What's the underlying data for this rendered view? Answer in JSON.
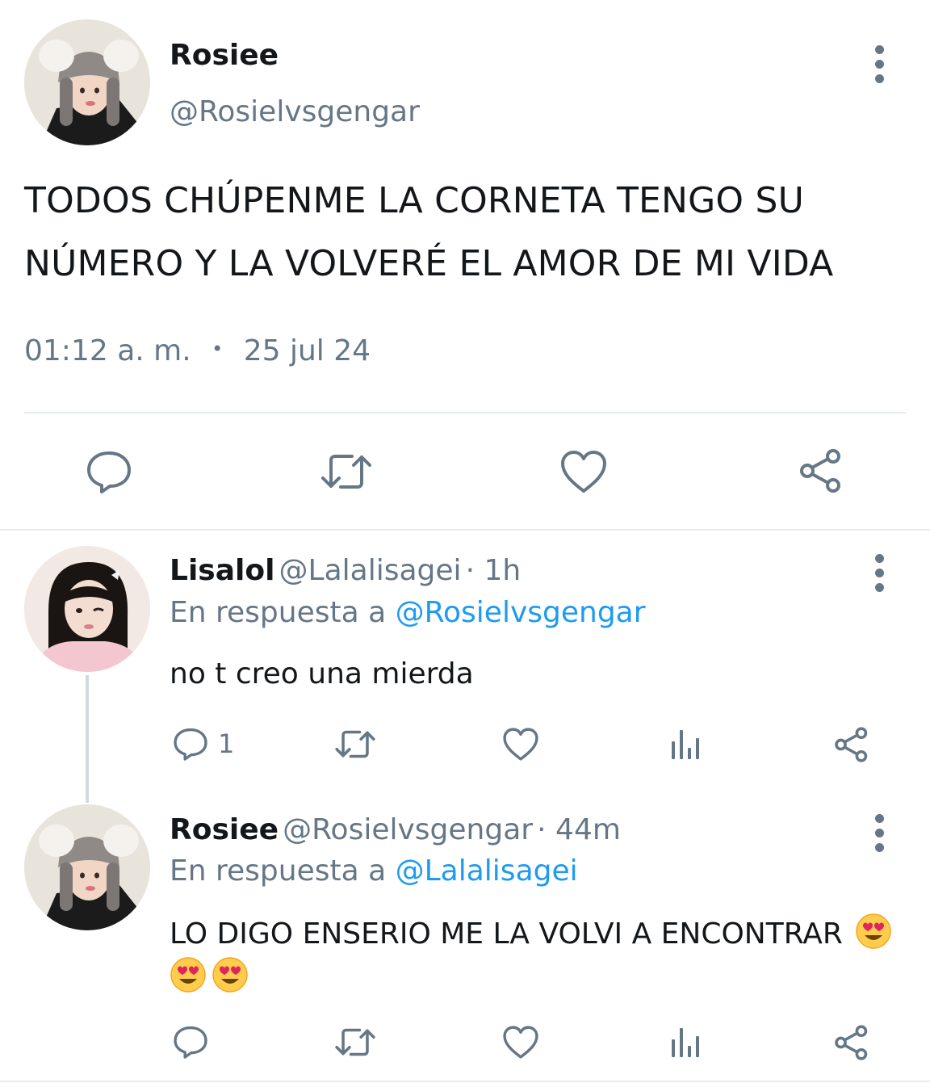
{
  "main_tweet": {
    "display_name": "Rosiee",
    "handle": "@Rosielvsgengar",
    "text": "TODOS CHÚPENME LA CORNETA TENGO SU NÚMERO Y LA VOLVERÉ EL AMOR DE MI VIDA",
    "time": "01:12 a. m.",
    "separator": "•",
    "date": "25 jul 24",
    "actions": [
      "reply-icon",
      "retweet-icon",
      "like-icon",
      "share-icon"
    ]
  },
  "replies": [
    {
      "display_name": "Lisalol",
      "handle": "@Lalalisagei",
      "age": "· 1h",
      "in_reply_prefix": "En respuesta a",
      "in_reply_to": "@Rosielvsgengar",
      "text": "no t creo una mierda",
      "reply_count": "1",
      "actions": [
        "reply-icon",
        "retweet-icon",
        "like-icon",
        "views-icon",
        "share-icon"
      ]
    },
    {
      "display_name": "Rosiee",
      "handle": "@Rosielvsgengar",
      "age": "· 44m",
      "in_reply_prefix": "En respuesta a",
      "in_reply_to": "@Lalalisagei",
      "text": "LO DIGO ENSERIO ME LA VOLVI A ENCONTRAR",
      "emoji": [
        "smiling-face-with-heart-eyes",
        "smiling-face-with-heart-eyes",
        "smiling-face-with-heart-eyes"
      ],
      "actions": [
        "reply-icon",
        "retweet-icon",
        "like-icon",
        "views-icon",
        "share-icon"
      ]
    }
  ],
  "colors": {
    "text": "#14171a",
    "secondary": "#657786",
    "link": "#1d9bf0",
    "divider": "#e6ecf0"
  }
}
